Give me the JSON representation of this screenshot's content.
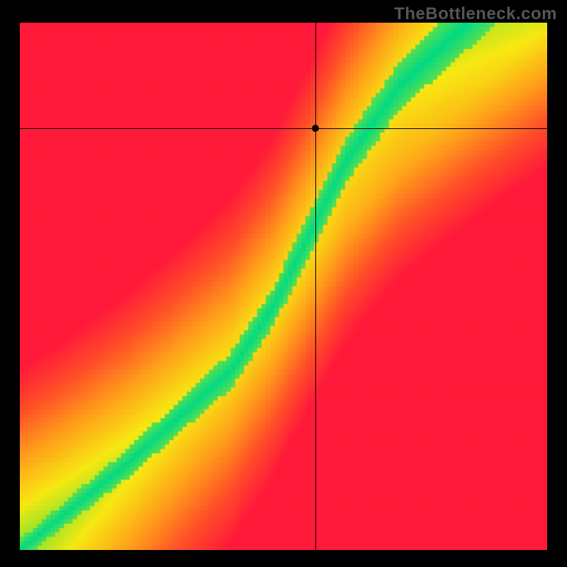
{
  "watermark": "TheBottleneck.com",
  "chart_data": {
    "type": "heatmap",
    "title": "",
    "xlabel": "",
    "ylabel": "",
    "xlim": [
      0,
      1
    ],
    "ylim": [
      0,
      1
    ],
    "grid_resolution": 120,
    "crosshair": {
      "x": 0.56,
      "y": 0.8
    },
    "marker": {
      "x": 0.56,
      "y": 0.8
    },
    "ridge": {
      "description": "Green optimum ridge from bottom-left to top-right with S-curve; remainder is red→orange→yellow gradient indicating mismatch.",
      "control_points_xy": [
        [
          0.0,
          0.0
        ],
        [
          0.2,
          0.16
        ],
        [
          0.4,
          0.34
        ],
        [
          0.48,
          0.46
        ],
        [
          0.55,
          0.6
        ],
        [
          0.62,
          0.74
        ],
        [
          0.72,
          0.88
        ],
        [
          0.85,
          1.0
        ]
      ],
      "band_half_width_low": 0.02,
      "band_half_width_high": 0.055
    },
    "color_stops": [
      {
        "t": 0.0,
        "color": "#00d985"
      },
      {
        "t": 0.15,
        "color": "#9fe427"
      },
      {
        "t": 0.3,
        "color": "#f7e812"
      },
      {
        "t": 0.55,
        "color": "#ff9d1a"
      },
      {
        "t": 0.78,
        "color": "#ff4e28"
      },
      {
        "t": 1.0,
        "color": "#ff1a3a"
      }
    ]
  }
}
